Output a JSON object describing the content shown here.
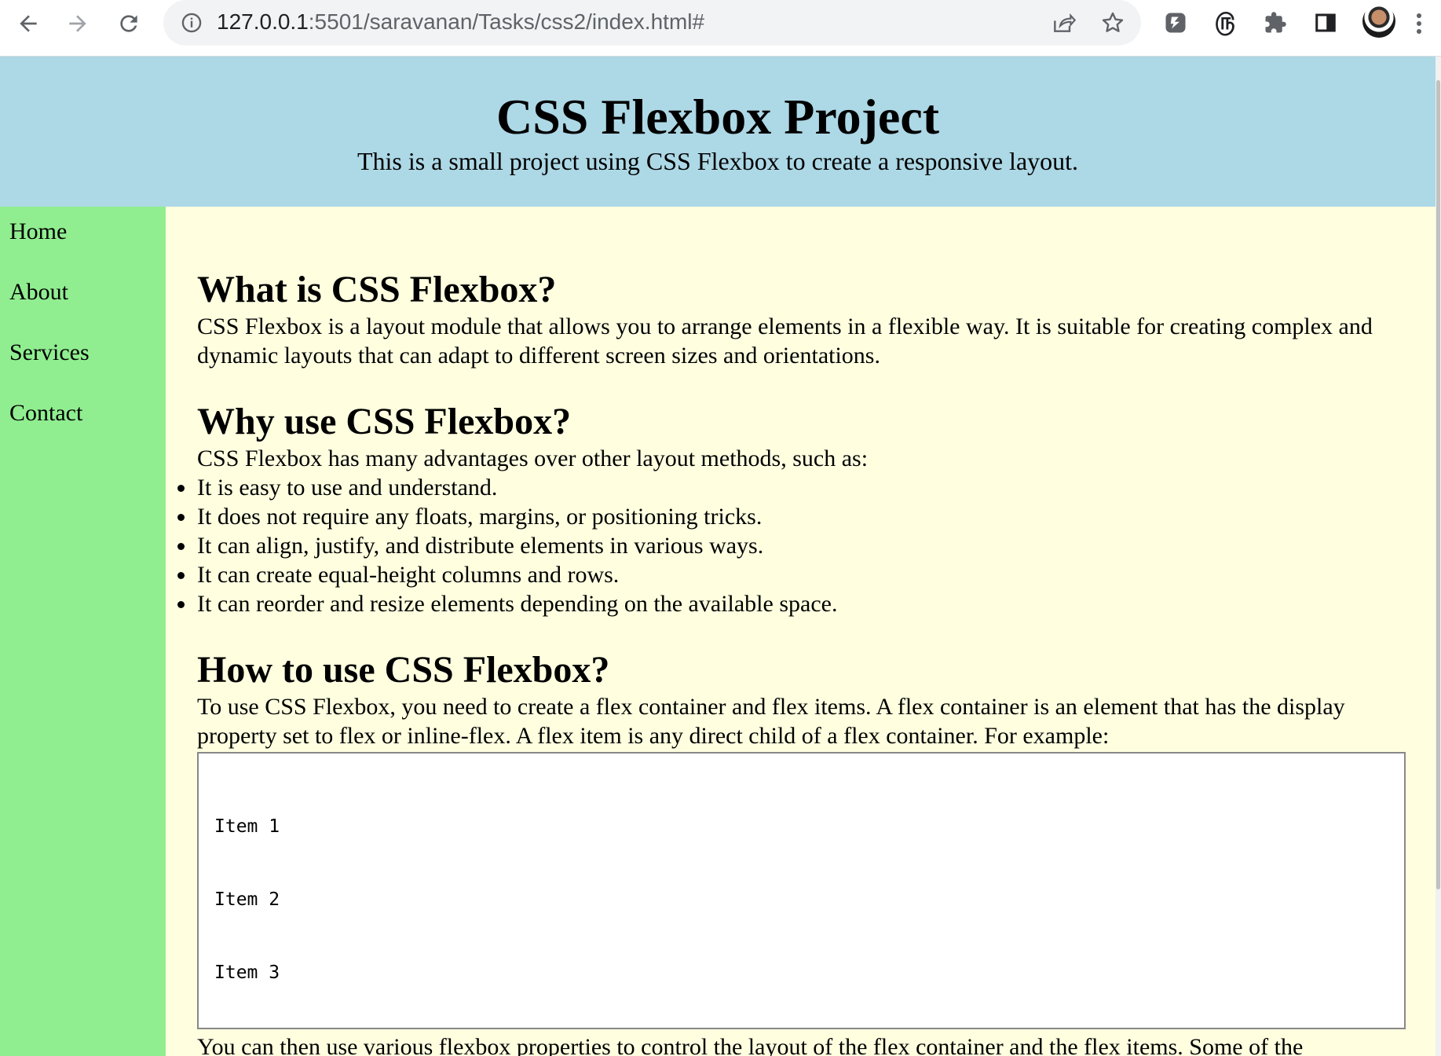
{
  "browser": {
    "url_host": "127.0.0.1",
    "url_rest": ":5501/saravanan/Tasks/css2/index.html#",
    "icons": [
      "back-arrow-icon",
      "forward-arrow-icon",
      "reload-icon",
      "site-info-icon",
      "share-icon",
      "bookmark-star-icon",
      "extension-icon",
      "extension-tamil-icon",
      "extensions-puzzle-icon",
      "side-panel-icon",
      "profile-avatar",
      "more-menu-icon"
    ]
  },
  "header": {
    "title": "CSS Flexbox Project",
    "subtitle": "This is a small project using CSS Flexbox to create a responsive layout."
  },
  "sidebar": {
    "items": [
      {
        "label": "Home"
      },
      {
        "label": "About"
      },
      {
        "label": "Services"
      },
      {
        "label": "Contact"
      }
    ]
  },
  "main": {
    "sections": [
      {
        "heading": "What is CSS Flexbox?",
        "text": "CSS Flexbox is a layout module that allows you to arrange elements in a flexible way. It is suitable for creating complex and dynamic layouts that can adapt to different screen sizes and orientations."
      },
      {
        "heading": "Why use CSS Flexbox?",
        "text": "CSS Flexbox has many advantages over other layout methods, such as:",
        "list": [
          "It is easy to use and understand.",
          "It does not require any floats, margins, or positioning tricks.",
          "It can align, justify, and distribute elements in various ways.",
          "It can create equal-height columns and rows.",
          "It can reorder and resize elements depending on the available space."
        ]
      },
      {
        "heading": "How to use CSS Flexbox?",
        "text": "To use CSS Flexbox, you need to create a flex container and flex items. A flex container is an element that has the display property set to flex or inline-flex. A flex item is any direct child of a flex container. For example:",
        "example_items": [
          "Item 1",
          "Item 2",
          "Item 3"
        ],
        "after_text": "You can then use various flexbox properties to control the layout of the flex container and the flex items. Some of the"
      }
    ]
  },
  "colors": {
    "header_bg": "#add8e6",
    "sidebar_bg": "#90ee90",
    "main_bg": "#ffffe0"
  }
}
